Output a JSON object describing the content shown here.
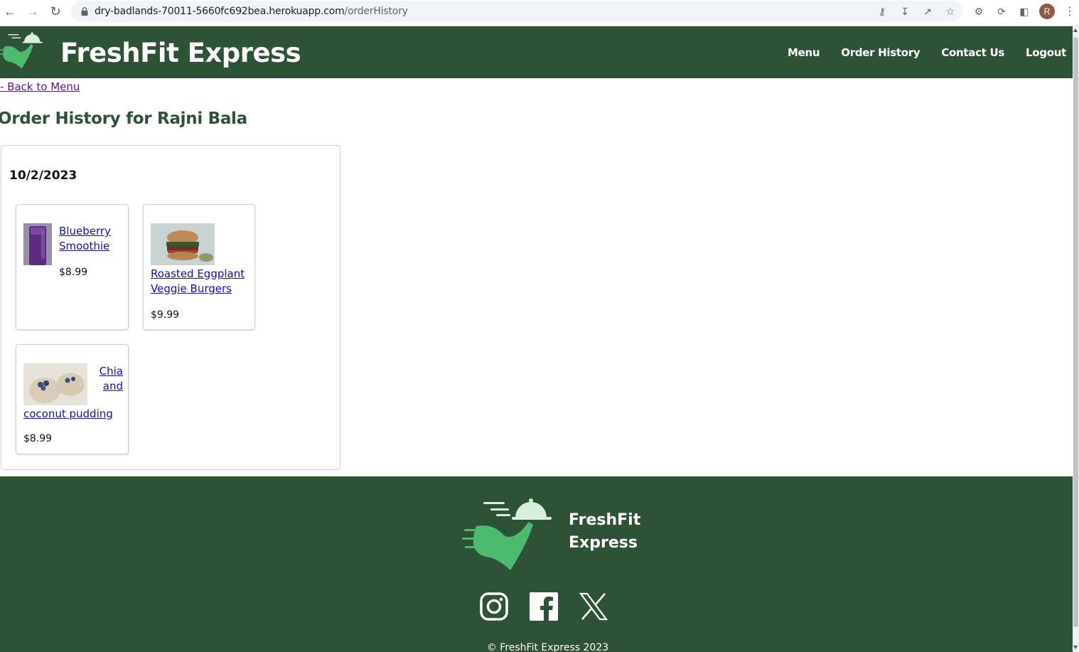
{
  "browser": {
    "url_host": "dry-badlands-70011-5660fc692bea.herokuapp.com",
    "url_path": "/orderHistory",
    "profile_initial": "R"
  },
  "header": {
    "brand": "FreshFit Express",
    "nav": [
      "Menu",
      "Order History",
      "Contact Us",
      "Logout"
    ]
  },
  "main": {
    "back_link": "- Back to Menu",
    "title": "Order History for Rajni Bala",
    "orders": [
      {
        "date": "10/2/2023",
        "items": [
          {
            "name": "Blueberry Smoothie",
            "price": "$8.99"
          },
          {
            "name": "Roasted Eggplant Veggie Burgers",
            "price": "$9.99"
          },
          {
            "name_part1": "Chia and",
            "name_part2": "coconut pudding",
            "price": "$8.99"
          }
        ]
      }
    ]
  },
  "footer": {
    "brand_line1": "FreshFit",
    "brand_line2": "Express",
    "social": [
      "instagram-icon",
      "facebook-icon",
      "x-icon"
    ],
    "copyright": "© FreshFit Express 2023"
  },
  "colors": {
    "brand_green": "#2e5236",
    "logo_green": "#4cbb6f",
    "link": "#1a0dab"
  }
}
